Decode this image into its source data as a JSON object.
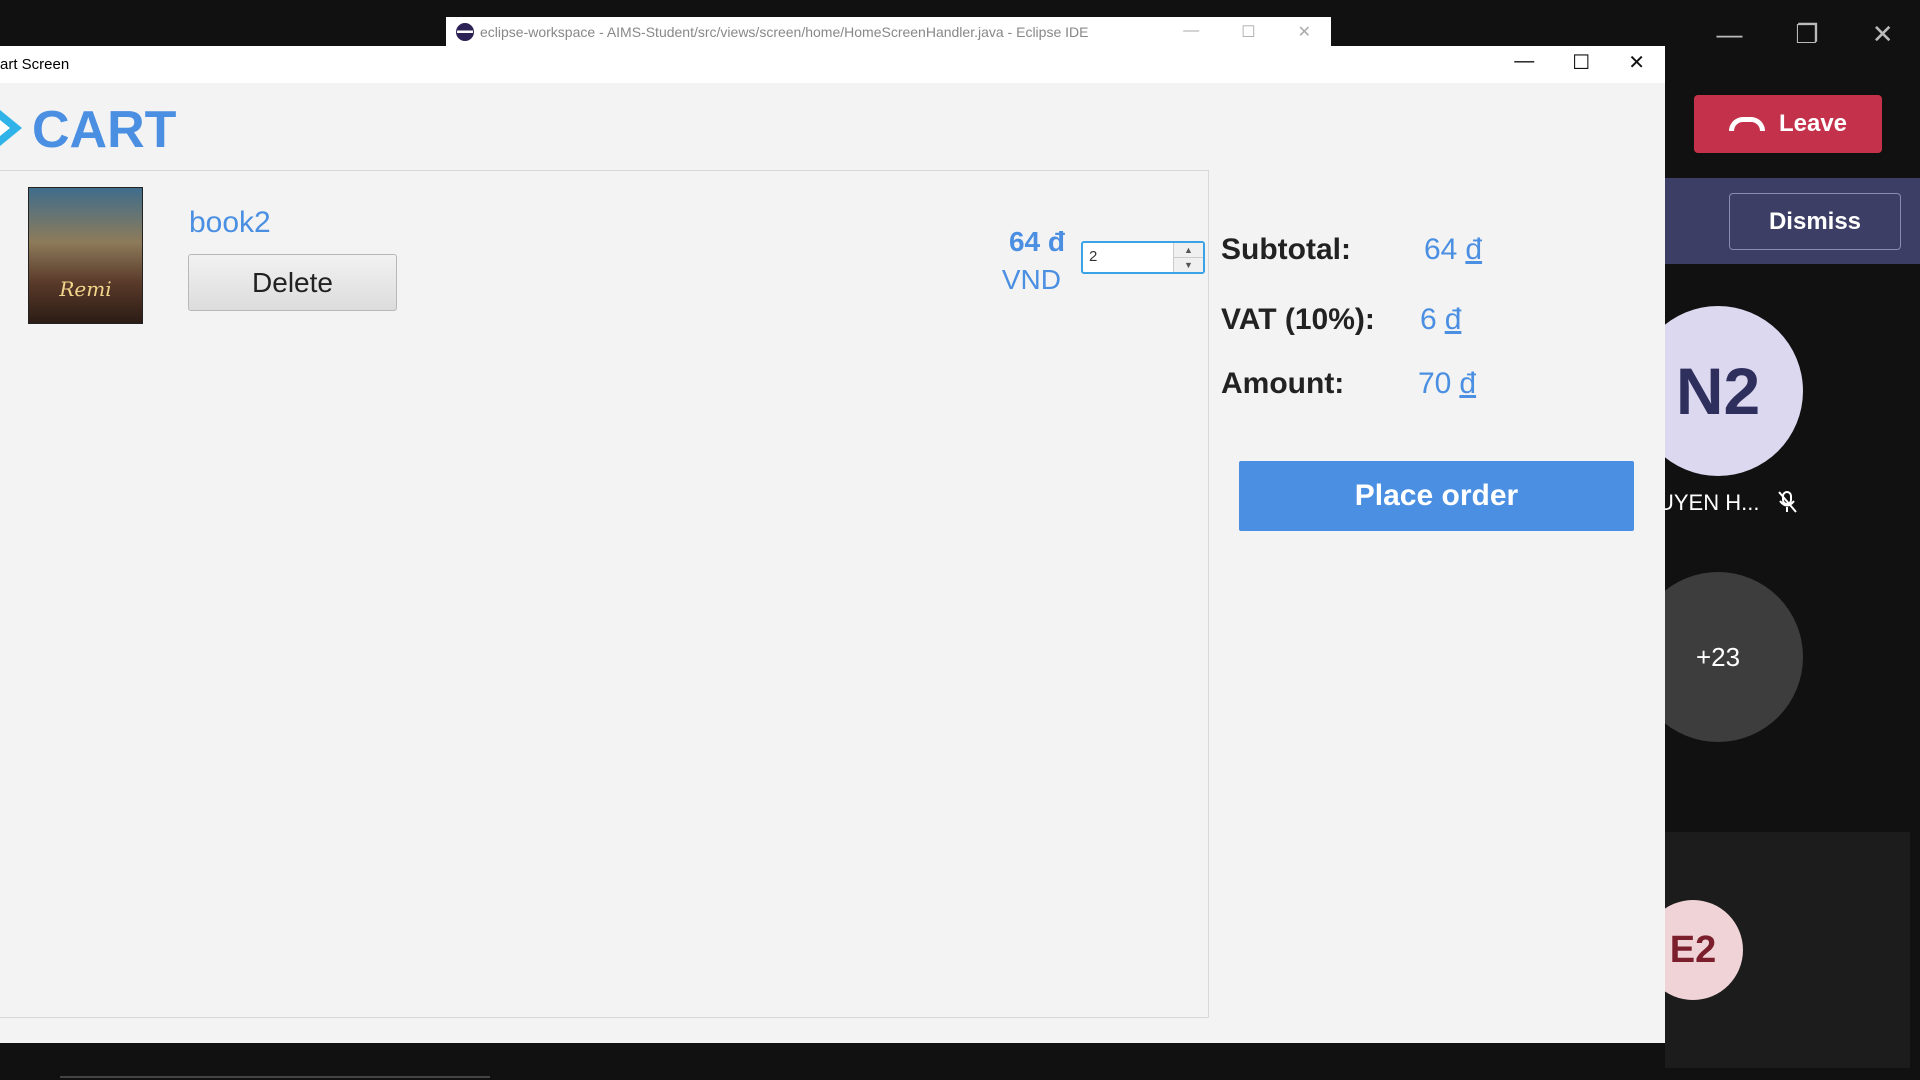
{
  "eclipse": {
    "title": "eclipse-workspace - AIMS-Student/src/views/screen/home/HomeScreenHandler.java - Eclipse IDE"
  },
  "teams": {
    "leave_label": "Leave",
    "dismiss_label": "Dismiss",
    "participant_initials": "N2",
    "participant_name": "UYEN H...",
    "more_count": "+23",
    "participant2_initials": "E2",
    "leave_color": "#c4314b"
  },
  "cart_window": {
    "title": "art Screen",
    "heading": "CART",
    "accent_color": "#4a8fe2",
    "item": {
      "title": "book2",
      "delete_label": "Delete",
      "price": "64 đ",
      "currency": "VND",
      "quantity": "2",
      "cover_text": "Remi"
    },
    "summary": {
      "subtotal_label": "Subtotal:",
      "subtotal_value": "64",
      "vat_label": "VAT (10%):",
      "vat_value": "6",
      "amount_label": "Amount:",
      "amount_value": "70",
      "currency_symbol": "đ"
    },
    "place_order_label": "Place order"
  }
}
